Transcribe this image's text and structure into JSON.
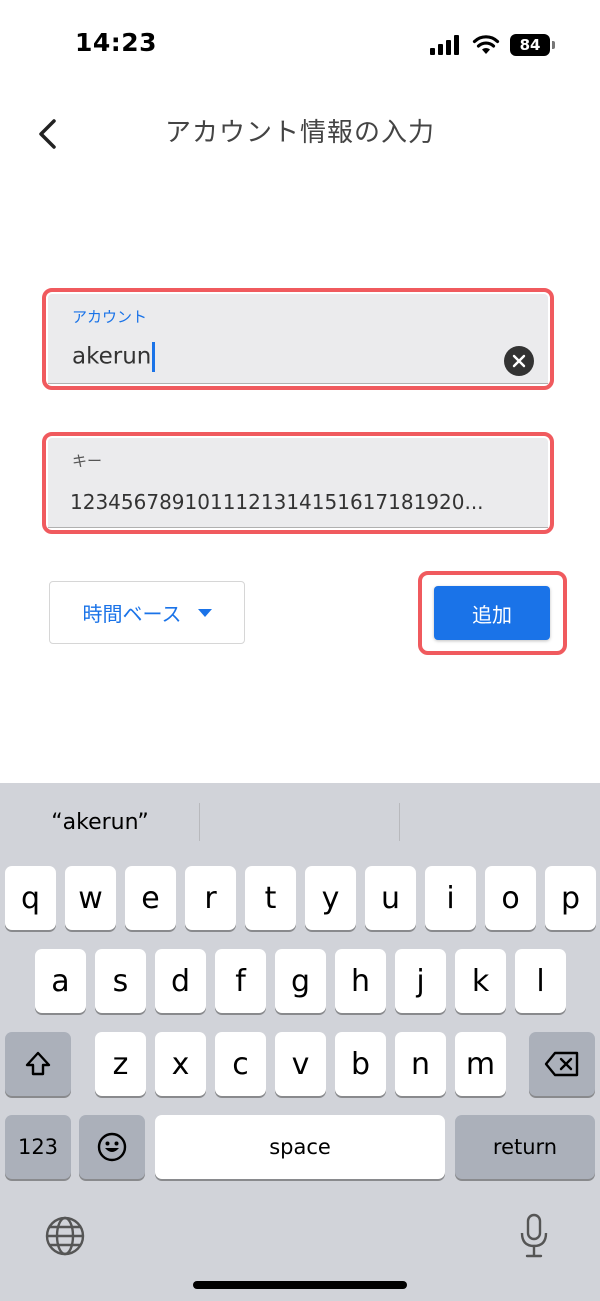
{
  "status": {
    "time": "14:23",
    "battery": "84"
  },
  "header": {
    "title": "アカウント情報の入力"
  },
  "form": {
    "account": {
      "label": "アカウント",
      "value": "akerun"
    },
    "key": {
      "label": "キー",
      "value": "1234567891011121314151617181920..."
    },
    "type_select": {
      "value": "時間ベース"
    },
    "add_label": "追加"
  },
  "colors": {
    "accent": "#1a73e8",
    "highlight": "#f05a5e",
    "field_bg": "#ebebed",
    "keyboard_bg": "#d1d3d9"
  },
  "keyboard": {
    "suggestion": "“akerun”",
    "row1": [
      "q",
      "w",
      "e",
      "r",
      "t",
      "y",
      "u",
      "i",
      "o",
      "p"
    ],
    "row2": [
      "a",
      "s",
      "d",
      "f",
      "g",
      "h",
      "j",
      "k",
      "l"
    ],
    "row3": [
      "z",
      "x",
      "c",
      "v",
      "b",
      "n",
      "m"
    ],
    "numbers_label": "123",
    "space_label": "space",
    "return_label": "return"
  },
  "icons": {
    "back": "chevron-left-icon",
    "clear": "close-circle-icon",
    "dropdown": "triangle-down-icon",
    "shift": "shift-icon",
    "delete": "backspace-icon",
    "emoji": "emoji-icon",
    "globe": "globe-icon",
    "mic": "microphone-icon"
  }
}
